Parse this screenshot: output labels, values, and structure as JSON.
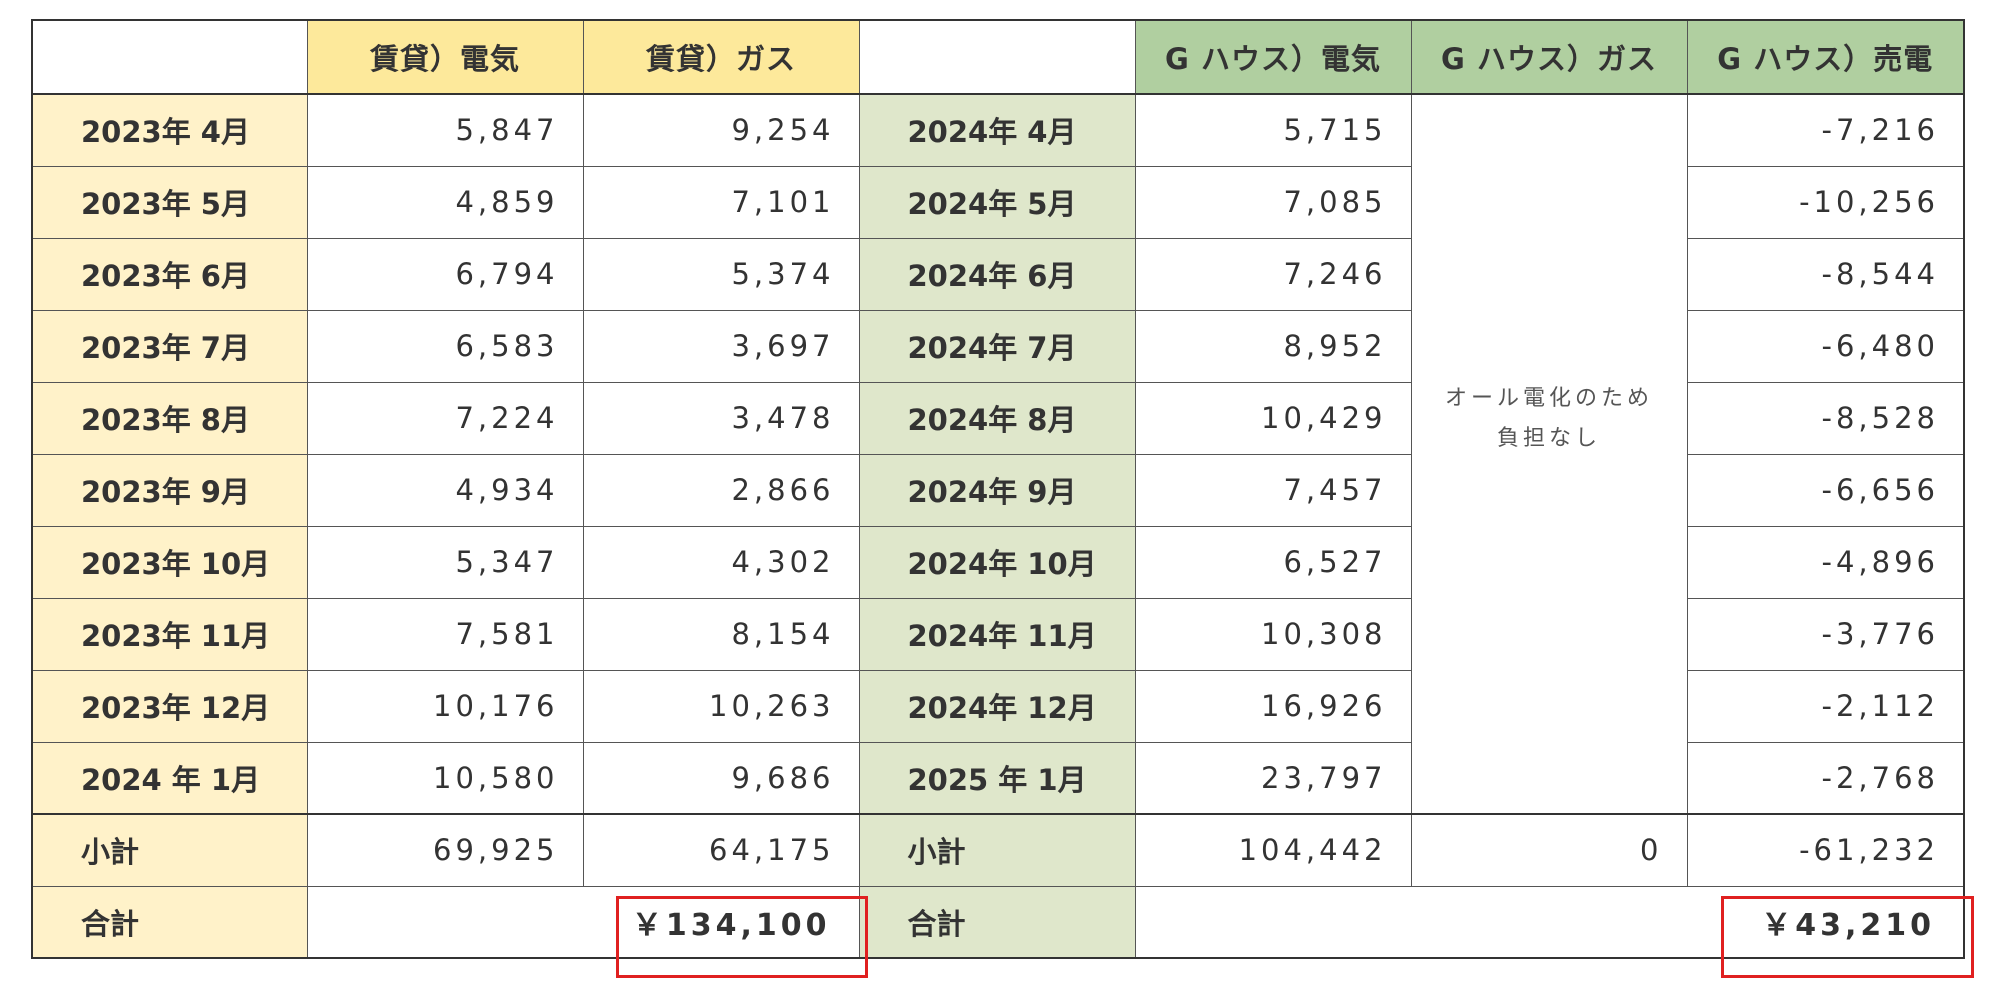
{
  "headers": {
    "rent_elec": "賃貸）電気",
    "rent_gas": "賃貸）ガス",
    "g_elec": "G ハウス）電気",
    "g_gas": "G ハウス）ガス",
    "g_sell": "G ハウス）売電"
  },
  "rows": [
    {
      "rent_month": "2023年 4月",
      "rent_elec": "5,847",
      "rent_gas": "9,254",
      "g_month": "2024年 4月",
      "g_elec": "5,715",
      "g_sell": "-7,216"
    },
    {
      "rent_month": "2023年 5月",
      "rent_elec": "4,859",
      "rent_gas": "7,101",
      "g_month": "2024年 5月",
      "g_elec": "7,085",
      "g_sell": "-10,256"
    },
    {
      "rent_month": "2023年 6月",
      "rent_elec": "6,794",
      "rent_gas": "5,374",
      "g_month": "2024年 6月",
      "g_elec": "7,246",
      "g_sell": "-8,544"
    },
    {
      "rent_month": "2023年 7月",
      "rent_elec": "6,583",
      "rent_gas": "3,697",
      "g_month": "2024年 7月",
      "g_elec": "8,952",
      "g_sell": "-6,480"
    },
    {
      "rent_month": "2023年 8月",
      "rent_elec": "7,224",
      "rent_gas": "3,478",
      "g_month": "2024年 8月",
      "g_elec": "10,429",
      "g_sell": "-8,528"
    },
    {
      "rent_month": "2023年 9月",
      "rent_elec": "4,934",
      "rent_gas": "2,866",
      "g_month": "2024年 9月",
      "g_elec": "7,457",
      "g_sell": "-6,656"
    },
    {
      "rent_month": "2023年 10月",
      "rent_elec": "5,347",
      "rent_gas": "4,302",
      "g_month": "2024年 10月",
      "g_elec": "6,527",
      "g_sell": "-4,896"
    },
    {
      "rent_month": "2023年 11月",
      "rent_elec": "7,581",
      "rent_gas": "8,154",
      "g_month": "2024年 11月",
      "g_elec": "10,308",
      "g_sell": "-3,776"
    },
    {
      "rent_month": "2023年 12月",
      "rent_elec": "10,176",
      "rent_gas": "10,263",
      "g_month": "2024年 12月",
      "g_elec": "16,926",
      "g_sell": "-2,112"
    },
    {
      "rent_month": "2024 年 1月",
      "rent_elec": "10,580",
      "rent_gas": "9,686",
      "g_month": "2025 年 1月",
      "g_elec": "23,797",
      "g_sell": "-2,768"
    }
  ],
  "gas_note": "オール電化のため\n負担なし",
  "subtotal": {
    "label": "小計",
    "rent_elec": "69,925",
    "rent_gas": "64,175",
    "g_label": "小計",
    "g_elec": "104,442",
    "g_gas": "0",
    "g_sell": "-61,232"
  },
  "total": {
    "label": "合計",
    "rent_total": "￥134,100",
    "g_label": "合計",
    "g_total": "￥43,210"
  },
  "colors": {
    "rent_header": "#fde99b",
    "rent_label": "#fff2c9",
    "g_header": "#b0cfa0",
    "g_label": "#dfe7cb",
    "highlight_box": "#e02020"
  }
}
